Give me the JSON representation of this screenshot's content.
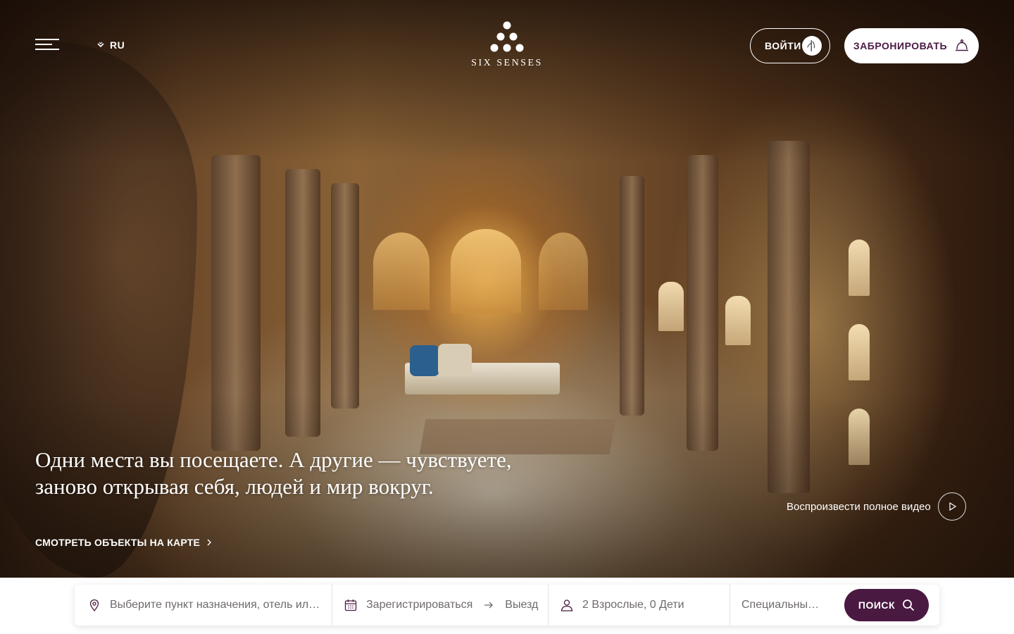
{
  "header": {
    "language": "RU",
    "logo_text": "SIX SENSES",
    "login_label": "ВОЙТИ",
    "book_label": "ЗАБРОНИРОВАТЬ"
  },
  "hero": {
    "tagline_line1": "Одни места вы посещаете. А другие — чувствуете,",
    "tagline_line2": "заново открывая себя, людей и мир вокруг.",
    "map_link": "СМОТРЕТЬ ОБЪЕКТЫ НА КАРТЕ",
    "video_link": "Воспроизвести полное видео"
  },
  "search": {
    "destination_placeholder": "Выберите пункт назначения, отель ил…",
    "checkin_label": "Зарегистрироваться",
    "checkout_label": "Выезд",
    "guests_label": "2 Взрослые, 0 Дети",
    "special_label": "Специальны…",
    "search_button": "ПОИСК"
  },
  "colors": {
    "brand": "#4a1942",
    "text_muted": "#6f6a6d",
    "white": "#ffffff"
  },
  "icons": {
    "menu": "menu-icon",
    "language": "chevron-down-icon",
    "login": "bamboo-icon",
    "book": "bell-icon",
    "map": "chevron-right-icon",
    "video": "play-icon",
    "destination": "location-pin-icon",
    "dates": "calendar-icon",
    "dates_arrow": "arrow-right-icon",
    "guests": "user-icon",
    "search": "search-icon"
  }
}
